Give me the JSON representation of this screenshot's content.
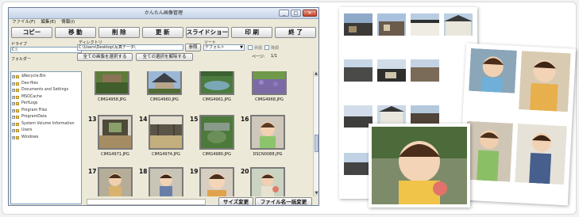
{
  "window": {
    "title": "かんたん画像管理",
    "controls": {
      "minimize": "_",
      "maximize": "□",
      "close": "×"
    }
  },
  "menu": [
    "ファイル(F)",
    "編集(E)",
    "情報(I)"
  ],
  "toolbar": {
    "copy": "コピー",
    "move": "移 動",
    "delete": "削 除",
    "update": "更 新",
    "slideshow": "スライドショー",
    "print": "印 刷",
    "exit": "終 了"
  },
  "controls": {
    "drive_label": "ドライブ",
    "drive_value": "C:\\",
    "folder_label": "フォルダー",
    "directory_label": "ディレクトリ",
    "directory_value": "C:\\Users\\Desktop\\写真データ\\",
    "browse_button": "参照",
    "select_all_button": "全ての画像を選択する",
    "deselect_all_button": "全ての選択を解除する",
    "sort_label": "ソート",
    "sort_value": "デフォルト",
    "option1": "昇順",
    "option2": "降順",
    "page_label": "ページ:",
    "page_value": "1/1"
  },
  "folders": [
    "$Recycle.Bin",
    "Dev-files",
    "Documents and Settings",
    "MSOCache",
    "PerfLogs",
    "Program Files",
    "ProgramData",
    "System Volume Information",
    "Users",
    "Windows"
  ],
  "thumbnails": {
    "row1": [
      {
        "label": "CIMG4958.JPG"
      },
      {
        "label": "CIMG4960.JPG"
      },
      {
        "label": "CIMG4961.JPG"
      },
      {
        "label": "CIMG4968.JPG"
      }
    ],
    "row2": [
      {
        "num": "13",
        "label": "CIMG4971.JPG"
      },
      {
        "num": "14",
        "label": "CIMG4974.JPG"
      },
      {
        "num": "15",
        "label": "CIMG4980.JPG"
      },
      {
        "num": "16",
        "label": "DSCN0088.JPG"
      }
    ],
    "row3": [
      {
        "num": "17"
      },
      {
        "num": "18"
      },
      {
        "num": "19"
      },
      {
        "num": "20"
      }
    ]
  },
  "bottom": {
    "resize_button": "サイズ変更",
    "rename_button": "ファイル名一括変更"
  },
  "colors": {
    "window_bg": "#ece9d8",
    "title_bg": "#c5d4e8",
    "selection_border": "#7a7a7a"
  }
}
